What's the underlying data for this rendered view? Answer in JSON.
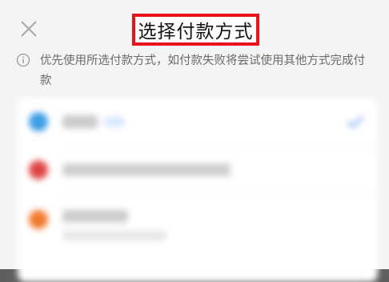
{
  "header": {
    "title": "选择付款方式"
  },
  "notice": {
    "text": "优先使用所选付款方式，如付款失败将尝试使用其他方式完成付款"
  },
  "payment_methods": [
    {
      "label": "",
      "color": "#3d9ee6",
      "badge_color": "#d7e6ff",
      "selected": true
    },
    {
      "label": "",
      "color": "#e04545",
      "selected": false
    },
    {
      "label": "",
      "color": "#f27b2f",
      "selected": false
    }
  ],
  "colors": {
    "title_highlight": "#e8141b",
    "check": "#4b86f5"
  },
  "icons": [
    "close-icon",
    "info-icon",
    "check-icon"
  ]
}
